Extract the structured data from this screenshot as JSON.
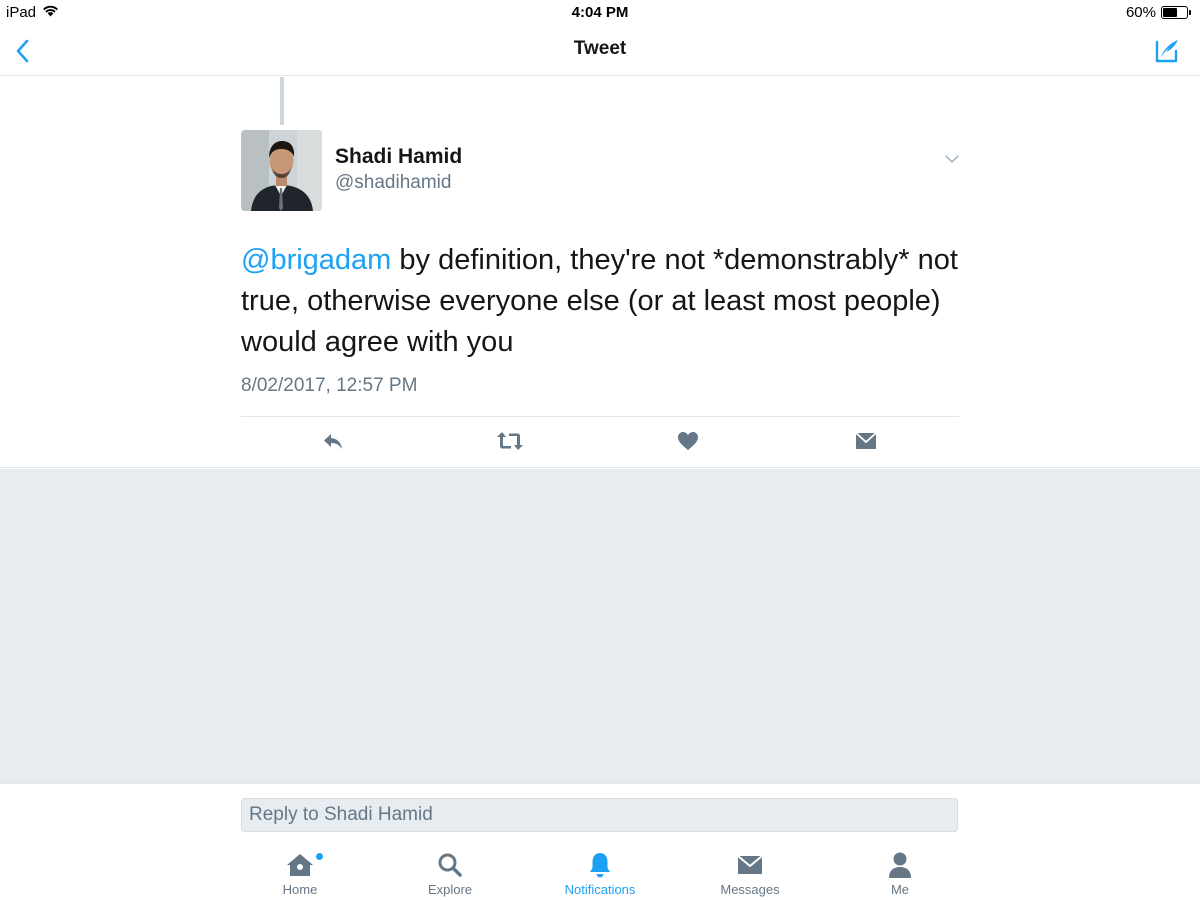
{
  "status_bar": {
    "device": "iPad",
    "time": "4:04 PM",
    "battery": "60%",
    "battery_level": 0.6
  },
  "nav": {
    "title": "Tweet"
  },
  "tweet": {
    "author_name": "Shadi Hamid",
    "author_handle": "@shadihamid",
    "mention": "@brigadam",
    "text": " by definition, they're not *demonstrably* not true, otherwise everyone else (or at least most people) would agree with you",
    "timestamp": "8/02/2017, 12:57 PM"
  },
  "reply": {
    "placeholder": "Reply to Shadi Hamid"
  },
  "tabs": [
    {
      "label": "Home",
      "icon": "home-icon"
    },
    {
      "label": "Explore",
      "icon": "search-icon"
    },
    {
      "label": "Notifications",
      "icon": "bell-icon",
      "active": true
    },
    {
      "label": "Messages",
      "icon": "envelope-icon"
    },
    {
      "label": "Me",
      "icon": "person-icon"
    }
  ],
  "colors": {
    "accent": "#1da1f2",
    "text": "#14171a",
    "muted": "#657786",
    "background_grey": "#e6ecf0"
  }
}
